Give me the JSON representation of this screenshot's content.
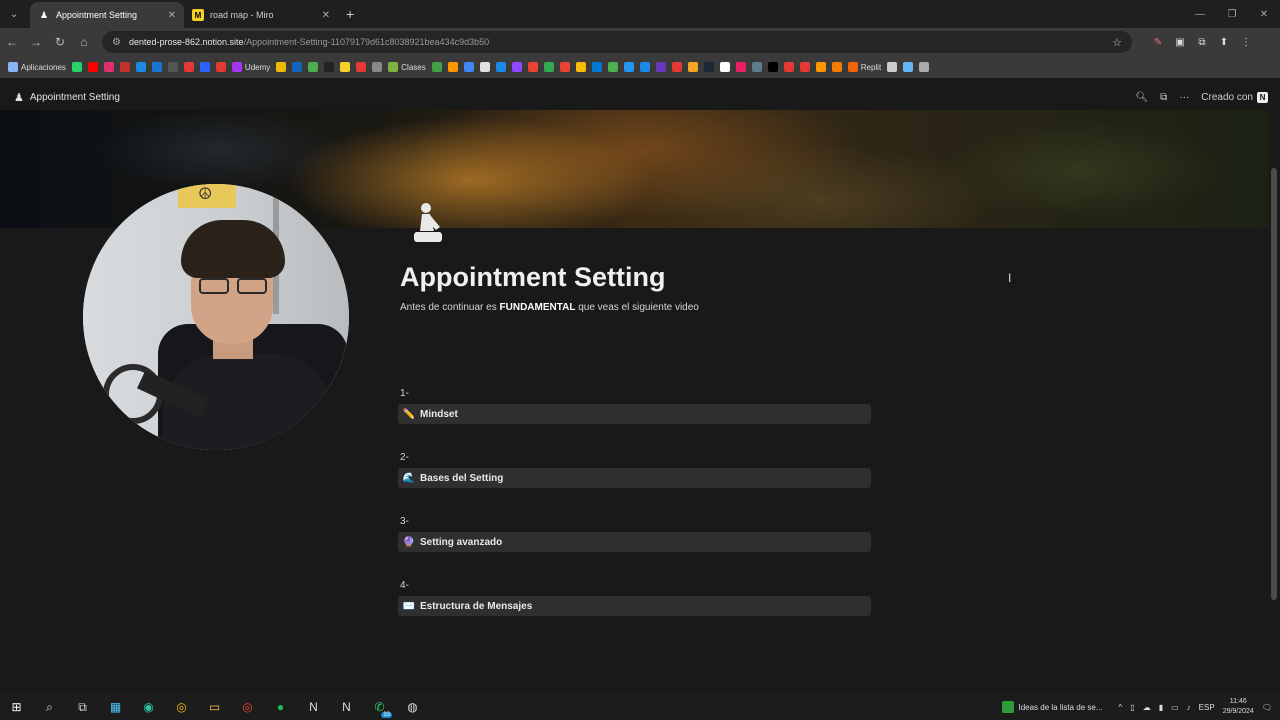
{
  "browser": {
    "tabs": [
      {
        "title": "Appointment Setting",
        "active": true,
        "icon": "notion-page-icon"
      },
      {
        "title": "road map - Miro",
        "active": false,
        "icon": "miro-icon"
      }
    ],
    "new_tab": "+",
    "url": {
      "domain": "dented-prose-862.notion.site",
      "path": "/Appointment-Setting-11079179d61c8038921bea434c9d3b50"
    },
    "bookmarks": [
      {
        "label": "Aplicaciones",
        "color": "#8ab4f8"
      },
      {
        "label": "",
        "color": "#25d366"
      },
      {
        "label": "",
        "color": "#ff0000"
      },
      {
        "label": "",
        "color": "#e1306c"
      },
      {
        "label": "",
        "color": "#c4302b"
      },
      {
        "label": "",
        "color": "#1e88e5"
      },
      {
        "label": "",
        "color": "#1976d2"
      },
      {
        "label": "",
        "color": "#555555"
      },
      {
        "label": "",
        "color": "#e53935"
      },
      {
        "label": "",
        "color": "#2962ff"
      },
      {
        "label": "",
        "color": "#e53935"
      },
      {
        "label": "Udemy",
        "color": "#a435f0"
      },
      {
        "label": "",
        "color": "#f0b90b"
      },
      {
        "label": "",
        "color": "#1565c0"
      },
      {
        "label": "",
        "color": "#4caf50"
      },
      {
        "label": "",
        "color": "#222222"
      },
      {
        "label": "",
        "color": "#f5d128"
      },
      {
        "label": "",
        "color": "#e53935"
      },
      {
        "label": "",
        "color": "#888888"
      },
      {
        "label": "Clases",
        "color": "#7cb342"
      },
      {
        "label": "",
        "color": "#43a047"
      },
      {
        "label": "",
        "color": "#ff9800"
      },
      {
        "label": "",
        "color": "#4285f4"
      },
      {
        "label": "",
        "color": "#e0e0e0"
      },
      {
        "label": "",
        "color": "#1e88e5"
      },
      {
        "label": "",
        "color": "#9146ff"
      },
      {
        "label": "",
        "color": "#ea4335"
      },
      {
        "label": "",
        "color": "#34a853"
      },
      {
        "label": "",
        "color": "#ea4335"
      },
      {
        "label": "",
        "color": "#fbbc05"
      },
      {
        "label": "",
        "color": "#0078d4"
      },
      {
        "label": "",
        "color": "#4caf50"
      },
      {
        "label": "",
        "color": "#2196f3"
      },
      {
        "label": "",
        "color": "#1e88e5"
      },
      {
        "label": "",
        "color": "#673ab7"
      },
      {
        "label": "",
        "color": "#e53935"
      },
      {
        "label": "",
        "color": "#f5a623"
      },
      {
        "label": "",
        "color": "#1b2838"
      },
      {
        "label": "",
        "color": "#ffffff"
      },
      {
        "label": "",
        "color": "#e91e63"
      },
      {
        "label": "",
        "color": "#607d8b"
      },
      {
        "label": "",
        "color": "#000000"
      },
      {
        "label": "",
        "color": "#e53935"
      },
      {
        "label": "",
        "color": "#e53935"
      },
      {
        "label": "",
        "color": "#ff9800"
      },
      {
        "label": "",
        "color": "#f57c00"
      },
      {
        "label": "Replit",
        "color": "#f26207"
      },
      {
        "label": "",
        "color": "#cccccc"
      },
      {
        "label": "",
        "color": "#64b5f6"
      },
      {
        "label": "",
        "color": "#aaaaaa"
      }
    ]
  },
  "notion": {
    "breadcrumb": "Appointment Setting",
    "created_with": "Creado con",
    "page_title": "Appointment Setting",
    "subtitle_pre": "Antes de continuar es ",
    "subtitle_bold": "FUNDAMENTAL",
    "subtitle_post": " que veas el siguiente video",
    "sections": [
      {
        "number": "1-",
        "label": "Mindset",
        "icon": "✏️"
      },
      {
        "number": "2-",
        "label": "Bases del Setting",
        "icon": "🌊"
      },
      {
        "number": "3-",
        "label": "Setting avanzado",
        "icon": "🔮"
      },
      {
        "number": "4-",
        "label": "Estructura de Mensajes",
        "icon": "✉️"
      }
    ]
  },
  "taskbar": {
    "whatsapp_badge": "33",
    "news_text": "Ideas de la lista de se...",
    "language": "ESP",
    "time": "11:46",
    "date": "29/9/2024"
  }
}
